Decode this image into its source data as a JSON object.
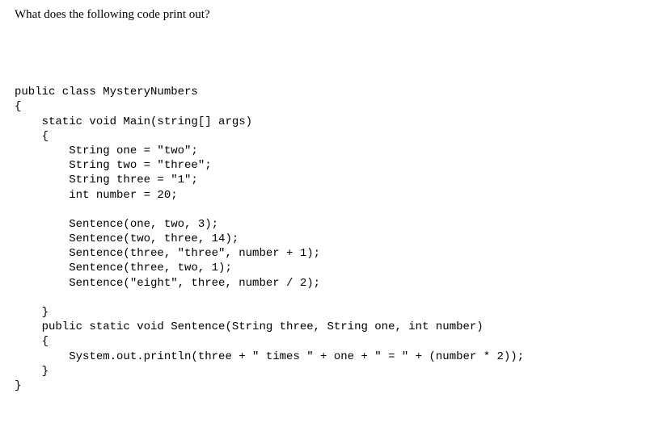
{
  "question": "What does the following code print out?",
  "code": {
    "lines": [
      "public class MysteryNumbers",
      "{",
      "    static void Main(string[] args)",
      "    {",
      "        String one = \"two\";",
      "        String two = \"three\";",
      "        String three = \"1\";",
      "        int number = 20;",
      "",
      "        Sentence(one, two, 3);",
      "        Sentence(two, three, 14);",
      "        Sentence(three, \"three\", number + 1);",
      "        Sentence(three, two, 1);",
      "        Sentence(\"eight\", three, number / 2);",
      "",
      "    }",
      "    public static void Sentence(String three, String one, int number)",
      "    {",
      "        System.out.println(three + \" times \" + one + \" = \" + (number * 2));",
      "    }",
      "}"
    ]
  }
}
